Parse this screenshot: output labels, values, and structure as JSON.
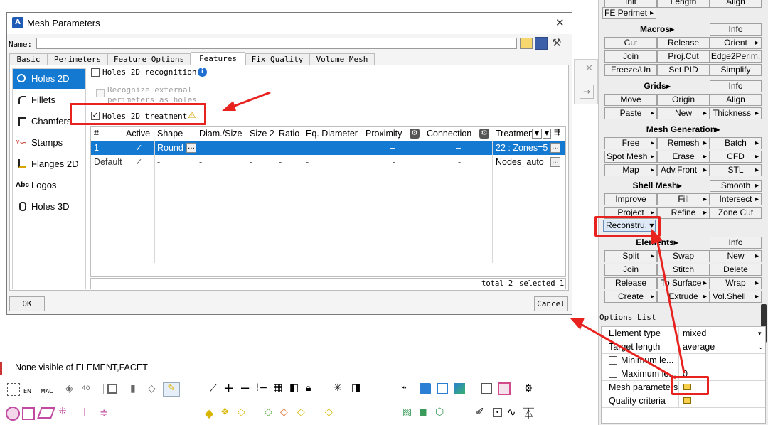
{
  "dialog": {
    "title": "Mesh Parameters",
    "close_glyph": "✕",
    "name_label": "Name:",
    "name_value": "",
    "tabs": [
      "Basic",
      "Perimeters",
      "Feature Options",
      "Features",
      "Fix Quality",
      "Volume Mesh"
    ],
    "active_tab": "Features",
    "sidebar": [
      {
        "label": "Holes 2D",
        "icon": "radio-circle-icon",
        "selected": true
      },
      {
        "label": "Fillets",
        "icon": "fillet-icon"
      },
      {
        "label": "Chamfers",
        "icon": "chamfer-icon"
      },
      {
        "label": "Stamps",
        "icon": "stamp-icon"
      },
      {
        "label": "Flanges 2D",
        "icon": "flange-icon"
      },
      {
        "label": "Logos",
        "icon": "abc-logo-icon",
        "icon_text": "Abc"
      },
      {
        "label": "Holes 3D",
        "icon": "cylinder-icon"
      }
    ],
    "holes2d_recognition": {
      "label": "Holes 2D recognition",
      "checked": false
    },
    "recognize_external": {
      "line1": "Recognize external",
      "line2": "perimeters as holes",
      "checked": false,
      "disabled": true
    },
    "holes2d_treatment": {
      "label": "Holes 2D treatment",
      "checked": true
    },
    "grid": {
      "columns": [
        "#",
        "Active",
        "Shape",
        "Diam./Size",
        "Size 2",
        "Ratio",
        "Eq. Diameter",
        "Proximity",
        "Connection",
        "Treatmen"
      ],
      "rows": [
        {
          "num": "1",
          "active": "✓",
          "shape": "Round",
          "diam": "",
          "size2": "",
          "ratio": "",
          "eqd": "",
          "proximity": "–",
          "connection": "–",
          "treatment": "22 : Zones=5",
          "selected": true
        },
        {
          "num": "Default",
          "active": "✓",
          "shape": "-",
          "diam": "-",
          "size2": "-",
          "ratio": "-",
          "eqd": "-",
          "proximity": "-",
          "connection": "-",
          "treatment": "Nodes=auto",
          "selected": false
        }
      ],
      "status_total": "total 2",
      "status_selected": "selected 1"
    },
    "ok_label": "OK",
    "cancel_label": "Cancel"
  },
  "side_arrows": {
    "close": "✕",
    "next": "→"
  },
  "panel": {
    "top_row": [
      "Init",
      "Length",
      "Align"
    ],
    "fe_perimeter": "FE Perimet",
    "groups": [
      {
        "header": "Macros",
        "info": "Info",
        "rows": [
          [
            "Cut",
            "Release",
            "Orient"
          ],
          [
            "Join",
            "Proj.Cut",
            "Edge2Perim."
          ],
          [
            "Freeze/Un",
            "Set PID",
            "Simplify"
          ]
        ]
      },
      {
        "header": "Grids",
        "info": "Info",
        "rows": [
          [
            "Move",
            "Origin",
            "Align"
          ],
          [
            "Paste",
            "New",
            "Thickness"
          ]
        ]
      },
      {
        "header": "Mesh Generation",
        "rows": [
          [
            "Free",
            "Remesh",
            "Batch"
          ],
          [
            "Spot Mesh",
            "Erase",
            "CFD"
          ],
          [
            "Map",
            "Adv.Front",
            "STL"
          ]
        ]
      },
      {
        "header": "Shell Mesh",
        "info": "Smooth",
        "rows": [
          [
            "Improve",
            "Fill",
            "Intersect"
          ],
          [
            "Project",
            "Refine",
            "Zone Cut"
          ],
          [
            "Reconstru.",
            "",
            ""
          ]
        ]
      },
      {
        "header": "Elements",
        "info": "Info",
        "rows": [
          [
            "Split",
            "Swap",
            "New"
          ],
          [
            "Join",
            "Stitch",
            "Delete"
          ],
          [
            "Release",
            "To Surface",
            "Wrap"
          ],
          [
            "Create",
            "Extrude",
            "Vol.Shell"
          ]
        ]
      }
    ],
    "options_list_title": "Options List",
    "options": [
      {
        "label": "Element type",
        "value": "mixed"
      },
      {
        "label": "Target length",
        "value": "average"
      },
      {
        "label": "Minimum le...",
        "value": "",
        "checkbox": true
      },
      {
        "label": "Maximum le...",
        "value": "0",
        "checkbox": true
      },
      {
        "label": "Mesh parameters",
        "value": "",
        "edit_icon": true
      },
      {
        "label": "Quality criteria",
        "value": "",
        "edit_icon": true
      }
    ]
  },
  "status_bar": {
    "text": "None visible of ELEMENT,FACET"
  },
  "toolbar": {
    "spin_value": "40",
    "labels": [
      "ENT",
      "MAC"
    ]
  },
  "colors": {
    "accent": "#1479d0",
    "annotation_red": "#e8231f",
    "selection": "#1479d0"
  }
}
